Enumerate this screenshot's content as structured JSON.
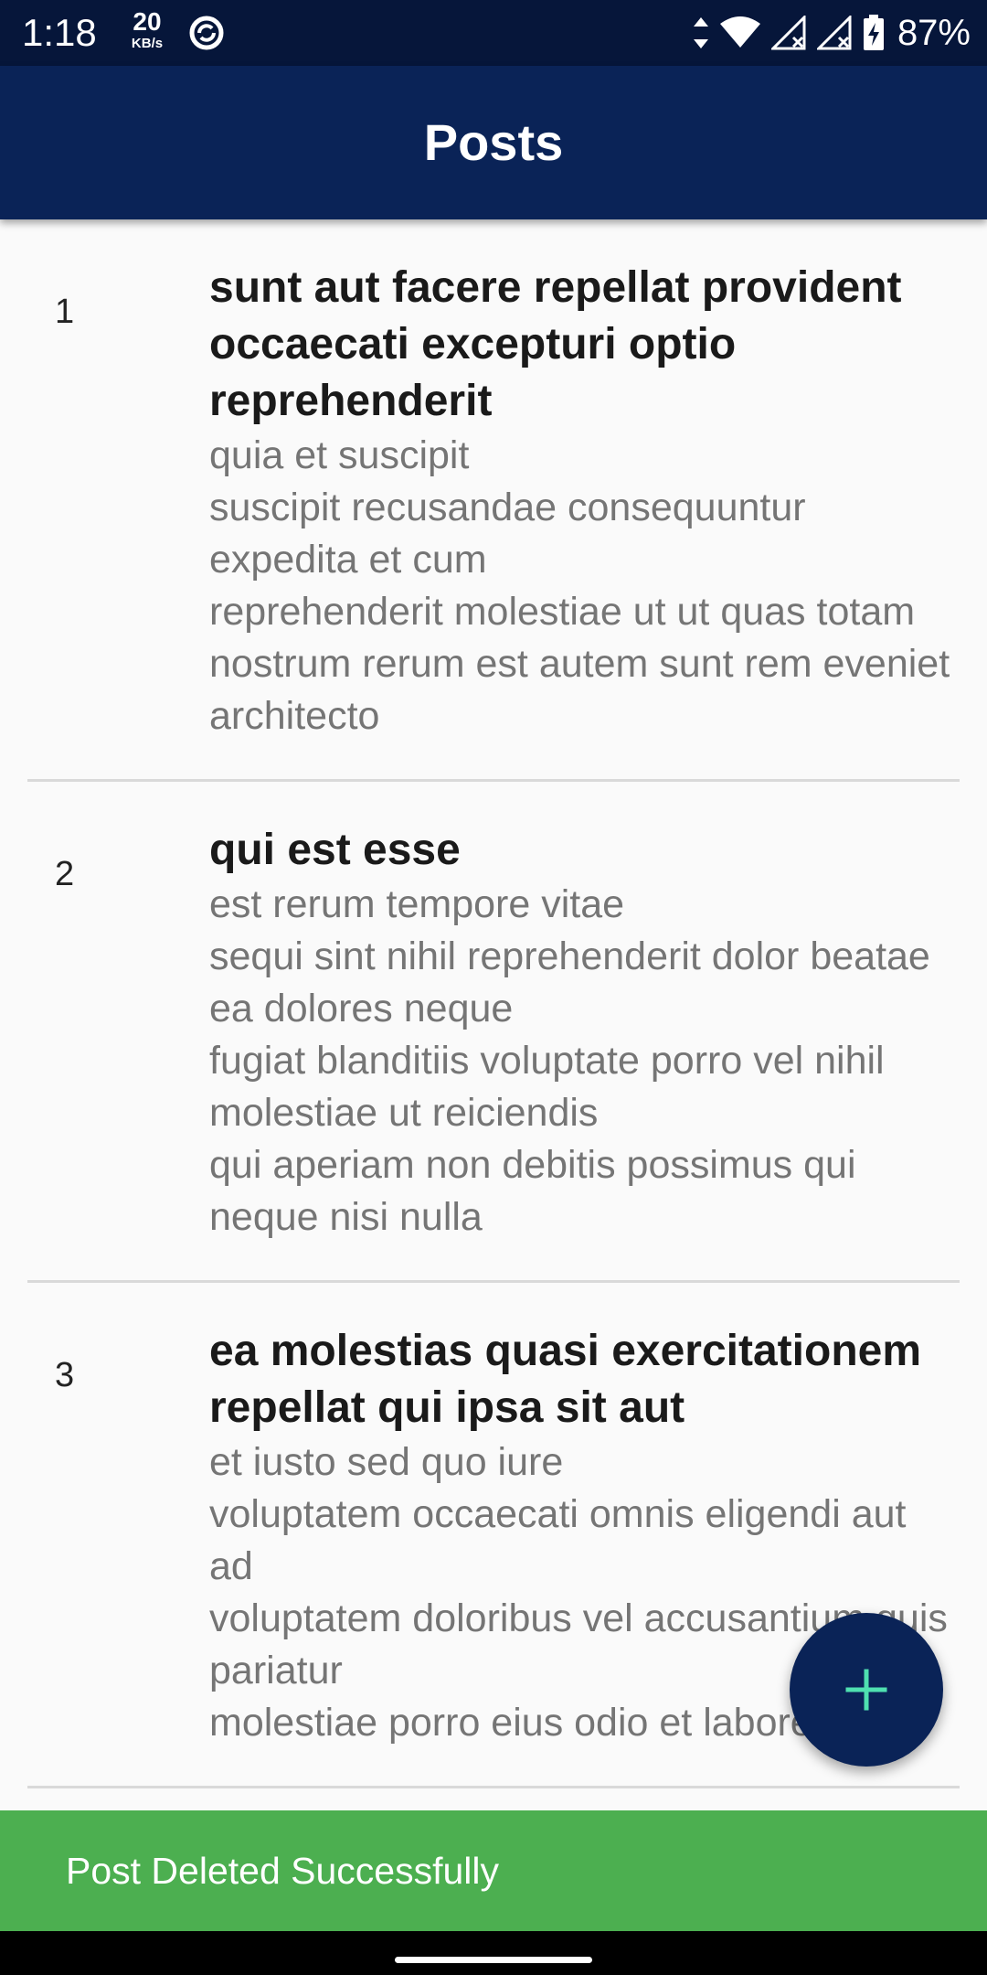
{
  "status_bar": {
    "time": "1:18",
    "net_speed_value": "20",
    "net_speed_unit": "KB/s",
    "battery": "87%",
    "icons": [
      "sync-icon",
      "data-arrows-icon",
      "wifi-icon",
      "signal-no-service-icon",
      "signal-no-service-icon",
      "battery-charging-icon"
    ]
  },
  "app_bar": {
    "title": "Posts"
  },
  "posts": [
    {
      "id": "1",
      "title": "sunt aut facere repellat provident occaecati excepturi optio reprehenderit",
      "body": "quia et suscipit\nsuscipit recusandae consequuntur expedita et cum\nreprehenderit molestiae ut ut quas totam\nnostrum rerum est autem sunt rem eveniet architecto"
    },
    {
      "id": "2",
      "title": "qui est esse",
      "body": "est rerum tempore vitae\nsequi sint nihil reprehenderit dolor beatae ea dolores neque\nfugiat blanditiis voluptate porro vel nihil molestiae ut reiciendis\nqui aperiam non debitis possimus qui neque nisi nulla"
    },
    {
      "id": "3",
      "title": "ea molestias quasi exercitationem repellat qui ipsa sit aut",
      "body": "et iusto sed quo iure\nvoluptatem occaecati omnis eligendi aut ad\nvoluptatem doloribus vel accusantium quis pariatur\nmolestiae porro eius odio et labore"
    }
  ],
  "fab": {
    "icon": "plus-icon",
    "icon_color": "#4fe0b0"
  },
  "snackbar": {
    "message": "Post Deleted Successfully",
    "color": "#4caf50"
  },
  "colors": {
    "status_bar": "#06163a",
    "app_bar": "#0a2357",
    "background": "#fafafa"
  }
}
